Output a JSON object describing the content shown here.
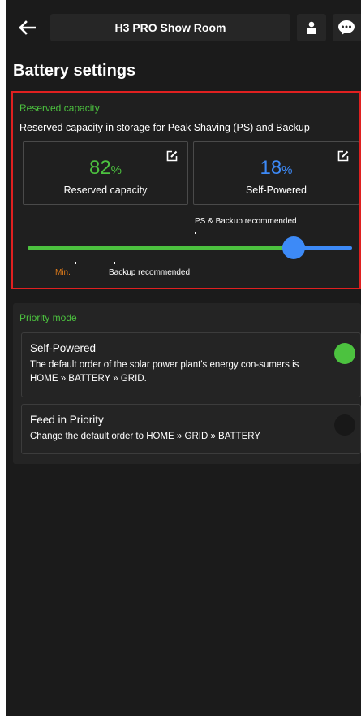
{
  "header": {
    "title": "H3 PRO Show Room"
  },
  "page": {
    "title": "Battery settings"
  },
  "reserved": {
    "section_label": "Reserved capacity",
    "description": "Reserved capacity in storage for Peak Shaving (PS) and Backup",
    "left_card": {
      "value": "82",
      "unit": "%",
      "label": "Reserved capacity"
    },
    "right_card": {
      "value": "18",
      "unit": "%",
      "label": "Self-Powered"
    },
    "ps_backup_label": "PS & Backup recommended",
    "min_label": "Min.",
    "backup_label": "Backup recommended",
    "slider_value_percent": 82
  },
  "priority": {
    "section_label": "Priority mode",
    "modes": [
      {
        "title": "Self-Powered",
        "description": "The default order of the solar power plant's energy con-sumers is HOME » BATTERY » GRID.",
        "selected": true
      },
      {
        "title": "Feed in Priority",
        "description": "Change the default order to HOME » GRID » BATTERY",
        "selected": false
      }
    ]
  },
  "colors": {
    "accent_green": "#4cc23f",
    "accent_blue": "#3d8af7",
    "min_orange": "#e07b1a",
    "highlight_red": "#e02020"
  },
  "icons": [
    "back-arrow-icon",
    "user-icon",
    "chat-icon",
    "edit-icon"
  ]
}
